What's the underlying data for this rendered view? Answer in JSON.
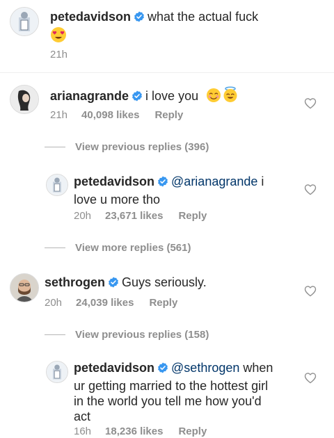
{
  "post": {
    "username": "petedavidson",
    "caption": "what the actual fuck",
    "time": "21h"
  },
  "comments": [
    {
      "username": "arianagrande",
      "text": "i love you",
      "time": "21h",
      "likes": "40,098 likes",
      "reply": "Reply",
      "view_replies": "View previous replies (396)",
      "reply_item": {
        "username": "petedavidson",
        "mention": "@arianagrande",
        "text_line1_rest": " i",
        "text_line2": "love u more tho",
        "time": "20h",
        "likes": "23,671 likes",
        "reply": "Reply"
      },
      "view_more": "View more replies (561)"
    },
    {
      "username": "sethrogen",
      "text": "Guys seriously.",
      "time": "20h",
      "likes": "24,039 likes",
      "reply": "Reply",
      "view_replies": "View previous replies (158)",
      "reply_item": {
        "username": "petedavidson",
        "mention": "@sethrogen",
        "text_line1_rest": " when",
        "text_line2": "ur getting married to the hottest girl",
        "text_line3": "in the world you tell me how you'd",
        "text_line4": "act",
        "time": "16h",
        "likes": "18,236 likes",
        "reply": "Reply"
      }
    }
  ],
  "icons": {
    "verified": "verified-badge-icon",
    "like": "heart-outline-icon"
  },
  "colors": {
    "verified": "#3897f0",
    "secondary_text": "#8e8e8e",
    "mention": "#003569"
  }
}
